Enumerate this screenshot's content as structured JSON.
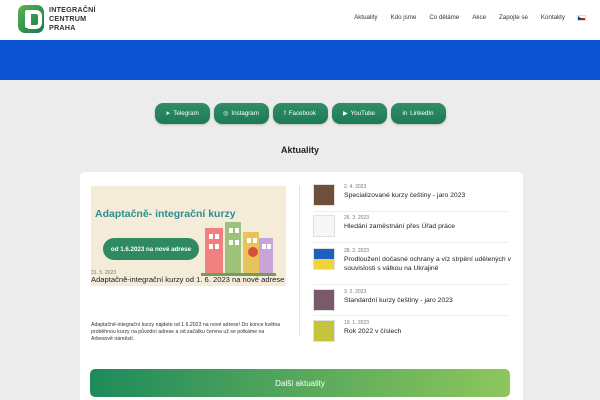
{
  "brand": {
    "line1": "INTEGRAČNÍ",
    "line2": "CENTRUM",
    "line3": "PRAHA"
  },
  "nav": [
    "Aktuality",
    "Kdo jsme",
    "Co děláme",
    "Akce",
    "Zapojte se",
    "Kontakty"
  ],
  "colors": {
    "accent": "#1d7a55",
    "banner": "#0a52cf",
    "bg": "#ececec"
  },
  "socials": [
    {
      "label": "Telegram",
      "icon": "telegram-icon"
    },
    {
      "label": "Instagram",
      "icon": "instagram-icon"
    },
    {
      "label": "Facebook",
      "icon": "facebook-icon"
    },
    {
      "label": "YouTube",
      "icon": "youtube-icon"
    },
    {
      "label": "LinkedIn",
      "icon": "linkedin-icon"
    }
  ],
  "section_title": "Aktuality",
  "featured": {
    "image_headline": "Adaptačně- integrační kurzy",
    "image_pill": "od 1.6.2023 na nové adrese",
    "date": "31. 5. 2023",
    "title": "Adaptačně-integrační kurzy od 1. 6. 2023 na nové adrese",
    "text": "Adaptačně-integrační kurzy najdete od 1.6.2023 na nové adrese! Do konce května proběhnou kurzy na původní adrese a od začátku června už se potkáme na Arbesově náměstí."
  },
  "news": [
    {
      "date": "2. 4. 2023",
      "title": "Specializované kurzy češtiny - jaro 2023"
    },
    {
      "date": "26. 3. 2023",
      "title": "Hledání zaměstnání přes Úřad práce"
    },
    {
      "date": "28. 2. 2023",
      "title": "Prodloužení dočasné ochrany a víz strpění udělených v souvislosti s válkou na Ukrajině"
    },
    {
      "date": "3. 2. 2023",
      "title": "Standardní kurzy češtiny - jaro 2023"
    },
    {
      "date": "19. 1. 2023",
      "title": "Rok 2022 v číslech"
    }
  ],
  "more_button": "Další aktuality"
}
